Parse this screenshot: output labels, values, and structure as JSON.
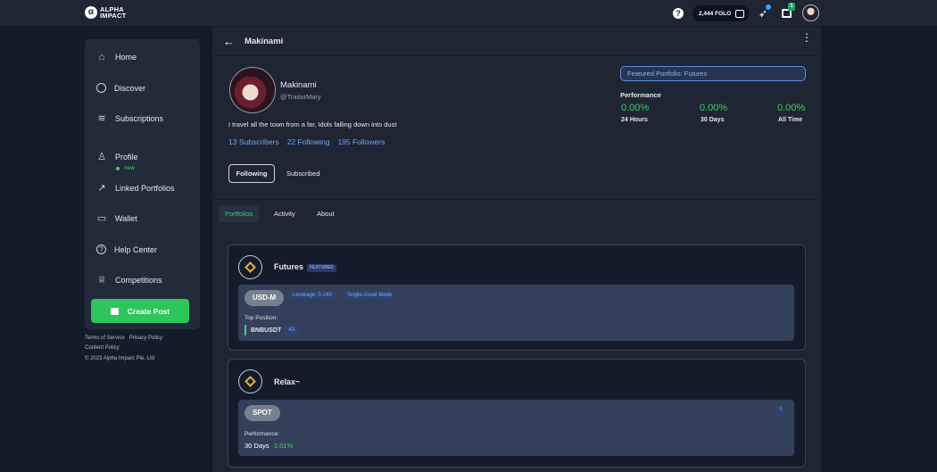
{
  "topbar": {
    "logo_mark": "α",
    "logo_line1": "ALPHA",
    "logo_line2": "IMPACT",
    "help_glyph": "?",
    "balance": "2,444 FOLO",
    "gift_badge": "1"
  },
  "sidebar": {
    "items": [
      {
        "label": "Home",
        "icon": "home-icon",
        "glyph": "⌂"
      },
      {
        "label": "Discover",
        "icon": "globe-icon",
        "glyph": ""
      },
      {
        "label": "Subscriptions",
        "icon": "wifi-icon",
        "glyph": "≋"
      },
      {
        "label": "Profile",
        "icon": "user-icon",
        "glyph": "♙"
      },
      {
        "label": "Linked Portfolios",
        "icon": "chart-icon",
        "glyph": "↗"
      },
      {
        "label": "Wallet",
        "icon": "wallet-icon",
        "glyph": "▭"
      },
      {
        "label": "Help Center",
        "icon": "help-icon",
        "glyph": "?"
      },
      {
        "label": "Competitions",
        "icon": "trophy-icon",
        "glyph": "♕"
      }
    ],
    "subscriptions_badge": "new",
    "create_post": "Create Post"
  },
  "footer": {
    "terms": "Terms of Service",
    "privacy": "Privacy Policy",
    "content": "Content Policy",
    "copyright": "© 2023 Alpha Impact Pte. Ltd"
  },
  "header": {
    "back_glyph": "←",
    "title": "Makinami",
    "menu_glyph": "⋮"
  },
  "profile": {
    "name": "Makinami",
    "handle": "@TraitorMary",
    "bio": "I travel all the town from a far, Idols falling down into dust",
    "subscribers": "13 Subscribers",
    "following": "22 Following",
    "followers": "195 Followers",
    "following_button": "Following",
    "subscribed_button": "Subscribed"
  },
  "performance": {
    "featured": "Featured Portfolio: Futures",
    "title": "Performance",
    "periods": [
      {
        "value": "0.00%",
        "label": "24 Hours"
      },
      {
        "value": "0.00%",
        "label": "30 Days"
      },
      {
        "value": "0.00%",
        "label": "All Time"
      }
    ]
  },
  "tabs": [
    "Portfolios",
    "Activity",
    "About"
  ],
  "portfolios": [
    {
      "name": "Futures",
      "tag": "FEATURED",
      "pill": "USD-M",
      "chips": [
        "Leverage: 0.14X",
        "Single-Asset Mode"
      ],
      "top_position_label": "Top Position:",
      "symbol": "BNBUSDT",
      "leverage": "4X"
    },
    {
      "name": "Relax~",
      "pill": "SPOT",
      "count": "6",
      "perf_label": "Performance:",
      "period": "30 Days",
      "value": "1.01%"
    }
  ],
  "colors": {
    "accent_green": "#3fcf6a",
    "link_blue": "#6aa8ff",
    "background": "#141b2b",
    "panel": "#1f2533"
  }
}
